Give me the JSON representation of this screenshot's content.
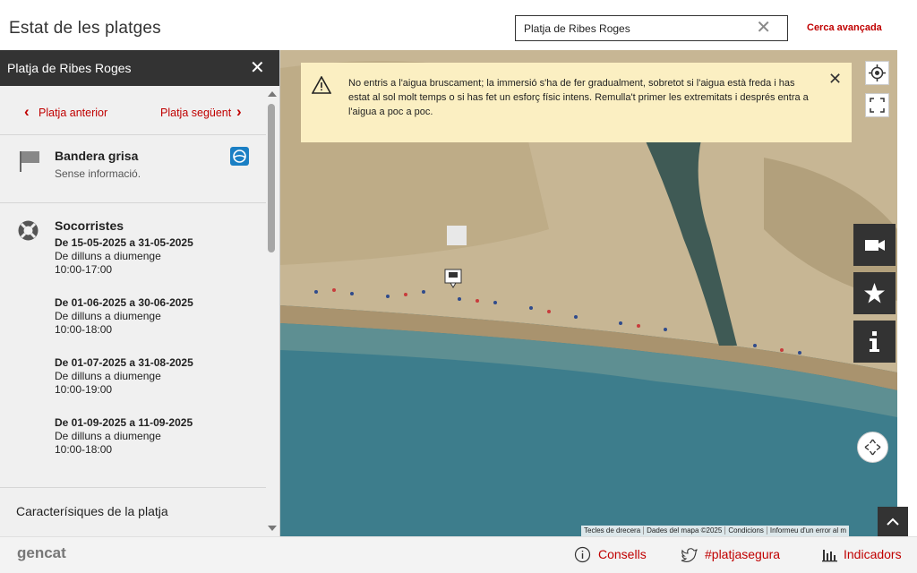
{
  "header": {
    "title": "Estat de les platges",
    "search_value": "Platja de Ribes Roges",
    "advanced_search": "Cerca avançada"
  },
  "sidebar": {
    "beach_name": "Platja de Ribes Roges",
    "prev_label": "Platja anterior",
    "next_label": "Platja següent",
    "flag": {
      "title": "Bandera grisa",
      "subtitle": "Sense informació.",
      "color": "#888888"
    },
    "lifeguards": {
      "title": "Socorristes",
      "periods": [
        {
          "dates": "De 15-05-2025 a 31-05-2025",
          "days": "De dilluns a diumenge",
          "hours": "10:00-17:00"
        },
        {
          "dates": "De 01-06-2025 a 30-06-2025",
          "days": "De dilluns a diumenge",
          "hours": "10:00-18:00"
        },
        {
          "dates": "De 01-07-2025 a 31-08-2025",
          "days": "De dilluns a diumenge",
          "hours": "10:00-19:00"
        },
        {
          "dates": "De 01-09-2025 a 11-09-2025",
          "days": "De dilluns a diumenge",
          "hours": "10:00-18:00"
        }
      ]
    },
    "characteristics_title": "Caracterísiques de la platja"
  },
  "alert": {
    "text": "No entris a l'aigua bruscament; la immersió s'ha de fer gradualment, sobretot si l'aigua està freda i has estat al sol molt temps o si has fet un esforç físic intens. Remulla't primer les extremitats i després entra a l'aigua a poc a poc."
  },
  "map": {
    "attribution": [
      "Tecles de drecera",
      "Dades del mapa ©2025",
      "Condicions",
      "Informeu d'un error al m"
    ]
  },
  "footer": {
    "logo": "gencat",
    "links": [
      "Consells",
      "#platjasegura",
      "Indicadors"
    ]
  },
  "colors": {
    "accent": "#c00000",
    "dark": "#333333",
    "alert_bg": "#fbefc2"
  }
}
